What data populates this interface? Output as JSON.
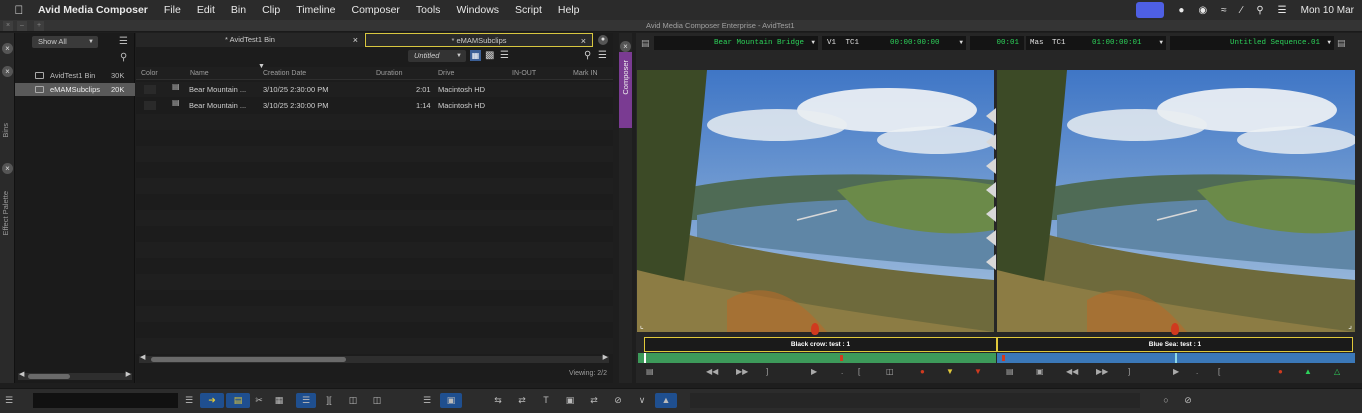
{
  "menubar": {
    "app_name": "Avid Media Composer",
    "items": [
      "File",
      "Edit",
      "Bin",
      "Clip",
      "Timeline",
      "Composer",
      "Tools",
      "Windows",
      "Script",
      "Help"
    ],
    "date": "Mon 10 Mar"
  },
  "window": {
    "title": "Avid Media Composer Enterprise - AvidTest1"
  },
  "left_strip": {
    "bins_label": "Bins",
    "effect_palette_label": "Effect Palette"
  },
  "bins_panel": {
    "filter": "Show All",
    "bins": [
      {
        "name": "AvidTest1 Bin",
        "size": "30K",
        "selected": false
      },
      {
        "name": "eMAMSubclips",
        "size": "20K",
        "selected": true
      }
    ]
  },
  "bin_area": {
    "tabs": [
      {
        "label": "* AvidTest1 Bin",
        "active": false
      },
      {
        "label": "* eMAMSubclips",
        "active": true
      }
    ],
    "view_name": "Untitled",
    "columns": [
      "Color",
      "Name",
      "Creation Date",
      "Duration",
      "Drive",
      "IN-OUT",
      "Mark IN"
    ],
    "rows": [
      {
        "name": "Bear Mountain ...",
        "creation_date": "3/10/25 2:30:00 PM",
        "duration": "2:01",
        "drive": "Macintosh HD"
      },
      {
        "name": "Bear Mountain ...",
        "creation_date": "3/10/25 2:30:00 PM",
        "duration": "1:14",
        "drive": "Macintosh HD"
      }
    ],
    "viewing": "Viewing: 2/2"
  },
  "composer": {
    "tab_label": "Composer",
    "source": {
      "clip_name": "Bear Mountain Bridge",
      "track": "V1",
      "tc_label": "TC1",
      "tc_value": "00:00:00:00",
      "duration": "00:01"
    },
    "record": {
      "track": "Mas",
      "tc_label": "TC1",
      "tc_value": "01:00:00:01",
      "sequence_name": "Untitled Sequence.01"
    },
    "source_marker_label": "Black crow: test : 1",
    "record_marker_label": "Blue Sea: test : 1",
    "source_bar_color": "#3d9a5a",
    "record_bar_color": "#3b78b8",
    "marker_color": "#d03a1f"
  },
  "colors": {
    "accent_yellow": "#d8c640",
    "composer_purple": "#7a3b92"
  }
}
